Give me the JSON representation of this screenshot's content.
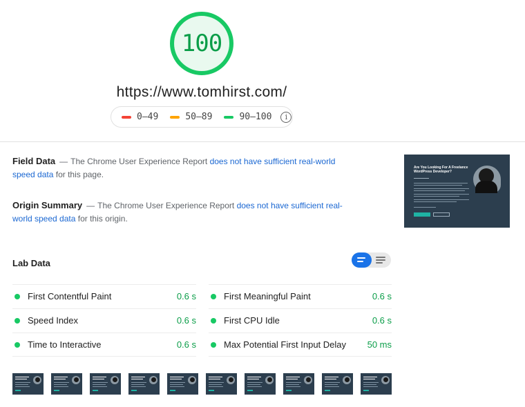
{
  "score": {
    "value": "100"
  },
  "page_url": "https://www.tomhirst.com/",
  "legend": {
    "items": [
      {
        "label": "0–49",
        "color": "#f44336"
      },
      {
        "label": "50–89",
        "color": "#ffa400"
      },
      {
        "label": "90–100",
        "color": "#18c964"
      }
    ],
    "info_icon": "info-icon"
  },
  "field_data": {
    "title": "Field Data",
    "dash": "—",
    "text_before": "The Chrome User Experience Report",
    "link": "does not have sufficient real-world speed data",
    "text_after": "for this page."
  },
  "origin_summary": {
    "title": "Origin Summary",
    "dash": "—",
    "text_before": "The Chrome User Experience Report",
    "link": "does not have sufficient real-world speed data",
    "text_after": "for this origin."
  },
  "lab_data": {
    "title": "Lab Data",
    "metrics": [
      {
        "label": "First Contentful Paint",
        "value": "0.6 s"
      },
      {
        "label": "First Meaningful Paint",
        "value": "0.6 s"
      },
      {
        "label": "Speed Index",
        "value": "0.6 s"
      },
      {
        "label": "First CPU Idle",
        "value": "0.6 s"
      },
      {
        "label": "Time to Interactive",
        "value": "0.6 s"
      },
      {
        "label": "Max Potential First Input Delay",
        "value": "50 ms"
      }
    ]
  },
  "screenshot": {
    "heading": "Are You Looking For A Freelance WordPress Developer?"
  },
  "colors": {
    "pass": "#18c964",
    "link": "#1a67d2",
    "toggle_active": "#1a73e8",
    "thumb_bg": "#2c3e4e"
  }
}
